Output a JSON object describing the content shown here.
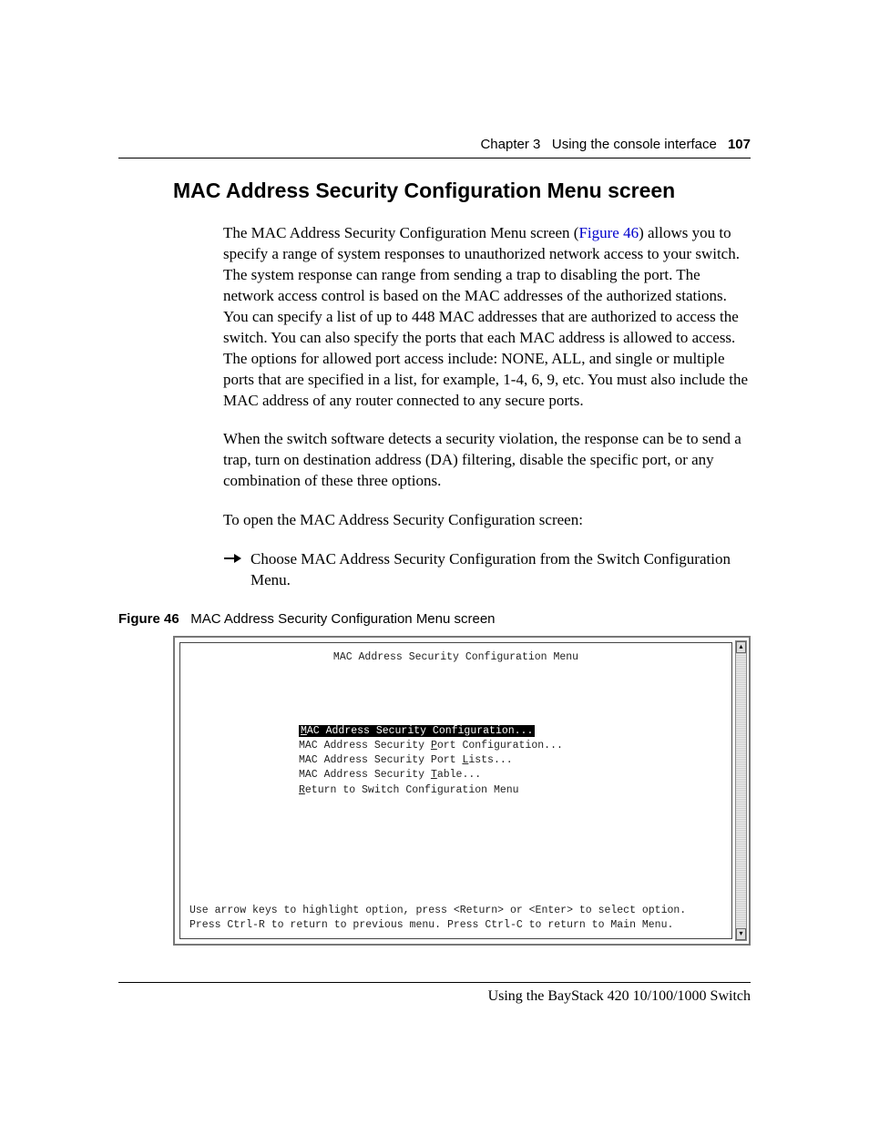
{
  "header": {
    "chapter": "Chapter 3",
    "section": "Using the console interface",
    "pagenum": "107"
  },
  "title": "MAC Address Security Configuration Menu screen",
  "para1a": "The MAC Address Security Configuration Menu screen (",
  "figref": "Figure 46",
  "para1b": ") allows you to specify a range of system responses to unauthorized network access to your switch. The system response can range from sending a trap to disabling the port. The network access control is based on the MAC addresses of the authorized stations. You can specify a list of up to 448 MAC addresses that are authorized to access the switch. You can also specify the ports that each MAC address is allowed to access. The options for allowed port access include: NONE, ALL, and single or multiple ports that are specified in a list, for example, 1-4, 6, 9, etc. You must also include the MAC address of any router connected to any secure ports.",
  "para2": "When the switch software detects a security violation, the response can be to send a trap, turn on destination address (DA) filtering, disable the specific port, or any combination of these three options.",
  "para3": "To open the MAC Address Security Configuration screen:",
  "step1": "Choose MAC Address Security Configuration from the Switch Configuration Menu.",
  "fig": {
    "label": "Figure 46",
    "title": "MAC Address Security Configuration Menu screen"
  },
  "terminal": {
    "title": "MAC Address Security Configuration Menu",
    "items": [
      {
        "pre": "",
        "u": "M",
        "post": "AC Address Security Configuration...",
        "selected": true
      },
      {
        "pre": "MAC Address Security ",
        "u": "P",
        "post": "ort Configuration...",
        "selected": false
      },
      {
        "pre": "MAC Address Security Port ",
        "u": "L",
        "post": "ists...",
        "selected": false
      },
      {
        "pre": "MAC Address Security ",
        "u": "T",
        "post": "able...",
        "selected": false
      },
      {
        "pre": "",
        "u": "R",
        "post": "eturn to Switch Configuration Menu",
        "selected": false
      }
    ],
    "help1": "Use arrow keys to highlight option, press <Return> or <Enter> to select option.",
    "help2": "Press Ctrl-R to return to previous menu.  Press Ctrl-C to return to Main Menu."
  },
  "footer": "Using the BayStack 420 10/100/1000 Switch"
}
